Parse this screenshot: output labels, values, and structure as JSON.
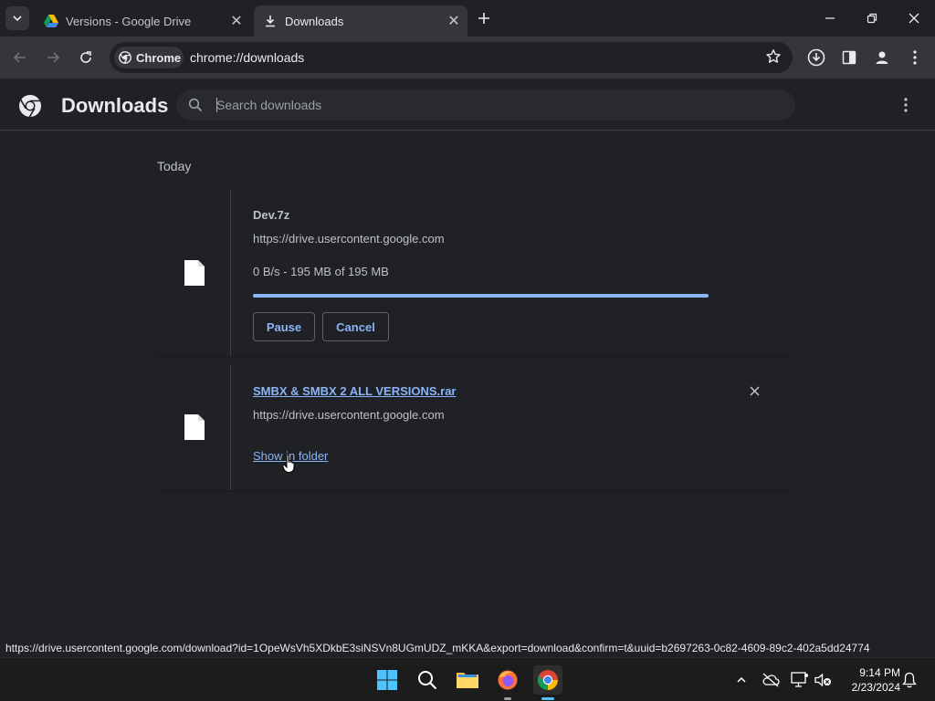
{
  "browser": {
    "tabs": [
      {
        "title": "Versions - Google Drive",
        "favicon": "google-drive-icon",
        "active": false
      },
      {
        "title": "Downloads",
        "favicon": "download-icon",
        "active": true
      }
    ],
    "chip_label": "Chrome",
    "address": "chrome://downloads"
  },
  "page": {
    "title": "Downloads",
    "search_placeholder": "Search downloads",
    "section_today": "Today"
  },
  "downloads": [
    {
      "filename": "Dev.7z",
      "source": "https://drive.usercontent.google.com",
      "status": "0 B/s - 195 MB of 195 MB",
      "progress": 1.0,
      "pause_label": "Pause",
      "cancel_label": "Cancel"
    },
    {
      "filename": "SMBX & SMBX 2 ALL VERSIONS.rar",
      "source": "https://drive.usercontent.google.com",
      "action_label": "Show in folder"
    }
  ],
  "status_url": "https://drive.usercontent.google.com/download?id=1OpeWsVh5XDkbE3siNSVn8UGmUDZ_mKKA&export=download&confirm=t&uuid=b2697263-0c82-4609-89c2-402a5dd24774",
  "taskbar": {
    "time": "9:14 PM",
    "date": "2/23/2024"
  },
  "colors": {
    "accent": "#8ab4f8",
    "background": "#202124",
    "toolbar": "#35363a"
  }
}
